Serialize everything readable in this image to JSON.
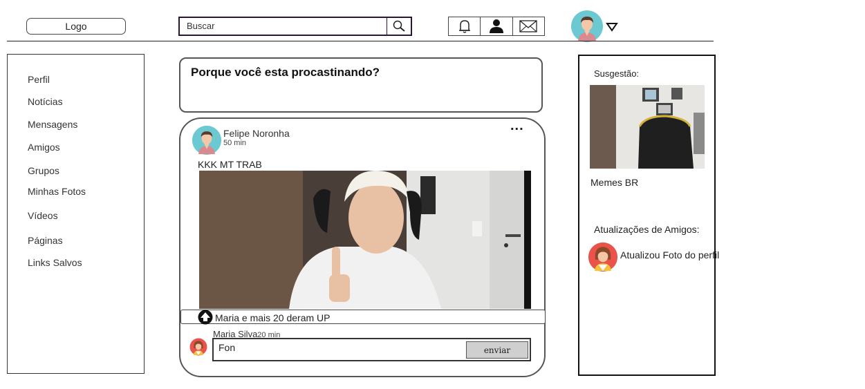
{
  "header": {
    "logo": "Logo",
    "search_placeholder": "Buscar",
    "icons": [
      "bell-icon",
      "user-icon",
      "mail-icon"
    ],
    "dropdown": "caret-down-icon"
  },
  "sidebar": {
    "items": [
      {
        "label": "Perfil"
      },
      {
        "label": "Notícias"
      },
      {
        "label": "Mensagens"
      },
      {
        "label": "Amigos"
      },
      {
        "label": "Grupos"
      },
      {
        "label": "Minhas Fotos"
      },
      {
        "label": "Vídeos"
      },
      {
        "label": "Páginas"
      },
      {
        "label": "Links Salvos"
      }
    ]
  },
  "composer": {
    "question": "Porque você esta procastinando?"
  },
  "post": {
    "author": "Felipe Noronha",
    "time": "50 min",
    "more": "...",
    "text": "KKK MT TRAB",
    "likes": "Maria e mais  20 deram UP",
    "comment": {
      "author": "Maria Silva",
      "time": "20 min",
      "input_value": "Fon",
      "send_label": "enviar"
    }
  },
  "right": {
    "suggestion_title": "Susgestão:",
    "suggestion_name": "Memes BR",
    "updates_title": "Atualizações de Amigos:",
    "update_text": "Atualizou Foto do perfil"
  },
  "colors": {
    "avatar_bg": "#6cc9d1",
    "avatar_female_bg": "#e9534a",
    "border": "#555555"
  }
}
